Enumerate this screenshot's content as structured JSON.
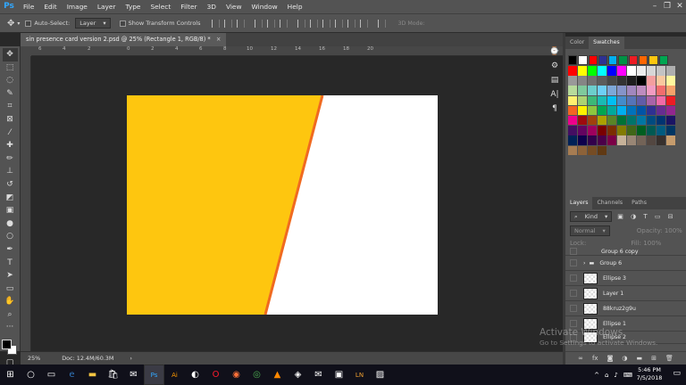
{
  "app": {
    "logo": "Ps"
  },
  "menu": [
    "File",
    "Edit",
    "Image",
    "Layer",
    "Type",
    "Select",
    "Filter",
    "3D",
    "View",
    "Window",
    "Help"
  ],
  "window_controls": {
    "minimize": "–",
    "maximize": "❐",
    "close": "✕"
  },
  "options": {
    "auto_select_label": "Auto-Select:",
    "auto_select_value": "Layer",
    "transform_label": "Show Transform Controls",
    "mode_3d": "3D Mode:"
  },
  "document": {
    "tab_title": "sin presence card version 2.psd @ 25% (Rectangle 1, RGB/8) *",
    "close": "×"
  },
  "rulers": {
    "top": [
      "6",
      "4",
      "2",
      "0",
      "2",
      "4",
      "6",
      "8",
      "10",
      "12",
      "14",
      "16",
      "18",
      "20"
    ]
  },
  "status": {
    "zoom": "25%",
    "doc": "Doc: 12.4M/60.3M"
  },
  "canvas": {
    "yellow": "#fec60f",
    "stripe": "#f06a20",
    "white": "#ffffff"
  },
  "panels": {
    "color_tabs": [
      "Color",
      "Swatches"
    ],
    "layer_tabs": [
      "Layers",
      "Channels",
      "Paths"
    ],
    "kind_filter": "Kind",
    "blend_mode": "Normal",
    "opacity_label": "Opacity:",
    "opacity_value": "100%",
    "lock_label": "Lock:",
    "fill_label": "Fill:",
    "fill_value": "100%"
  },
  "swatch_colors": [
    "#ff0000",
    "#ffff00",
    "#00ff00",
    "#00ffff",
    "#0000ff",
    "#ff00ff",
    "#ffffff",
    "#ececec",
    "#d7d7d7",
    "#c3c3c3",
    "#aeaeae",
    "#999999",
    "#858585",
    "#707070",
    "#5c5c5c",
    "#474747",
    "#333333",
    "#1e1e1e",
    "#000000",
    "#f49e9e",
    "#f9c89e",
    "#fff79e",
    "#b7db9b",
    "#7fca9c",
    "#6ccecc",
    "#6ecff6",
    "#7da8d8",
    "#8594c9",
    "#a187be",
    "#bd8cbf",
    "#f29bc2",
    "#f26d6d",
    "#f6a26b",
    "#fff26f",
    "#acd372",
    "#3cb878",
    "#1abbb4",
    "#00bff3",
    "#438ccb",
    "#5574b9",
    "#605ca8",
    "#a863a8",
    "#f06ba7",
    "#ed1c24",
    "#f26522",
    "#fff200",
    "#8dc63f",
    "#00a651",
    "#00a99d",
    "#00aeef",
    "#0072bc",
    "#0054a6",
    "#2e3192",
    "#662d91",
    "#92278f",
    "#ec008c",
    "#9e0b0f",
    "#a0410d",
    "#aba000",
    "#598527",
    "#007236",
    "#00746b",
    "#0076a3",
    "#004b80",
    "#003471",
    "#1b1464",
    "#440e62",
    "#630460",
    "#9e005d",
    "#790000",
    "#7b2e00",
    "#827b00",
    "#406618",
    "#005e20",
    "#005952",
    "#005b7f",
    "#003663",
    "#002157",
    "#0d004c",
    "#32004b",
    "#4b0049",
    "#7b0046",
    "#c7b299",
    "#998675",
    "#736357",
    "#534741",
    "#37302d",
    "#c69c6d",
    "#a67c52",
    "#8c6239",
    "#754c24",
    "#603913"
  ],
  "swatch_top": [
    "#000000",
    "#ffffff",
    "#ff0000",
    "#2e3192",
    "#00aeef",
    "#009245",
    "#ed1c24",
    "#ff6600",
    "#fec60f",
    "#00a651"
  ],
  "layers": [
    {
      "name": "Group 6 copy",
      "type": "group"
    },
    {
      "name": "Group 6",
      "type": "group"
    },
    {
      "name": "Ellipse 3",
      "type": "shape"
    },
    {
      "name": "Layer 1",
      "type": "pixel"
    },
    {
      "name": "88kruz2g9u",
      "type": "pixel"
    },
    {
      "name": "Ellipse 1",
      "type": "shape"
    },
    {
      "name": "Ellipse 2",
      "type": "shape"
    }
  ],
  "watermark": {
    "line1": "Activate Windows",
    "line2": "Go to Settings to activate Windows."
  },
  "taskbar": {
    "apps": [
      "start-icon",
      "search-icon",
      "task-view-icon",
      "edge-icon",
      "explorer-icon",
      "store-icon",
      "mail-icon",
      "photoshop-icon",
      "illustrator-icon",
      "app-icon",
      "opera-icon",
      "firefox-icon",
      "chrome-icon",
      "vlc-icon",
      "app2-icon",
      "mail2-icon",
      "app3-icon",
      "ln-icon",
      "photos-icon"
    ],
    "time": "5:46 PM",
    "date": "7/5/2018"
  }
}
